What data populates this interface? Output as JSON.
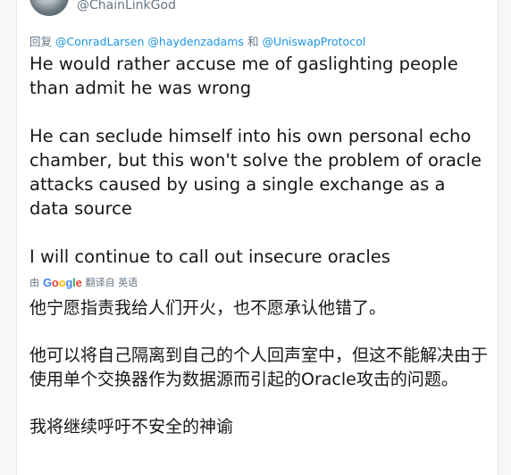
{
  "author": {
    "handle": "@ChainLinkGod"
  },
  "reply": {
    "prefix": "回复",
    "mention_1": "@ConradLarsen",
    "mention_2": "@haydenzadams",
    "conjunction": "和",
    "mention_3": "@UniswapProtocol"
  },
  "tweet": {
    "paragraph_1": "He would rather accuse me of gaslighting people than admit he was wrong",
    "paragraph_2": "He can seclude himself into his own personal echo chamber, but this won't solve the problem of oracle attacks caused by using a single exchange as a data source",
    "paragraph_3": "I will continue to call out insecure oracles"
  },
  "translation": {
    "by": "由",
    "provider_letters": [
      "G",
      "o",
      "o",
      "g",
      "l",
      "e"
    ],
    "label": "翻译自 英语",
    "paragraph_1": "他宁愿指责我给人们开火，也不愿承认他错了。",
    "paragraph_2": "他可以将自己隔离到自己的个人回声室中，但这不能解决由于使用单个交换器作为数据源而引起的Oracle攻击的问题。",
    "paragraph_3": "我将继续呼吁不安全的神谕"
  }
}
